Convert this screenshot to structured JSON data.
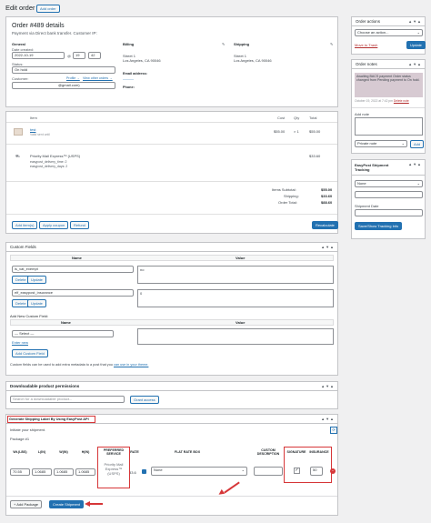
{
  "page": {
    "title": "Edit order",
    "add_order": "Add order"
  },
  "order": {
    "heading": "Order #489 details",
    "subheading": "Payment via Direct bank transfer. Customer IP: ",
    "general": {
      "title": "General",
      "date_label": "Date created:",
      "date": "2022-10-19",
      "at": "@",
      "hour": "19",
      "minute": "42",
      "status_label": "Status:",
      "status": "On hold",
      "customer_label": "Customer:",
      "profile_link": "Profile →",
      "other_orders_link": "View other orders →",
      "customer_value": "@gmail.com)"
    },
    "billing": {
      "title": "Billing",
      "address_line1": "Street 1",
      "address_line2": "Los Angeles, CA 90046",
      "email_label": "Email address:",
      "phone_label": "Phone:"
    },
    "shipping": {
      "title": "Shipping",
      "address_line1": "Street 1",
      "address_line2": "Los Angeles, CA 90046"
    }
  },
  "items": {
    "headers": {
      "item": "Item",
      "cost": "Cost",
      "qty": "Qty",
      "total": "Total"
    },
    "product": {
      "name": "test",
      "meta": "Valid sent until",
      "cost": "$55.00",
      "qty": "× 1",
      "total": "$55.00"
    },
    "shipping_line": {
      "name": "Priority Mail Express™ (USPS)",
      "meta1": "easypost_delivery_time: 2",
      "meta2": "easypost_delivery_days: 2",
      "total": "$33.60"
    },
    "totals": [
      {
        "label": "Items Subtotal:",
        "value": "$55.00"
      },
      {
        "label": "Shipping:",
        "value": "$33.60"
      },
      {
        "label": "Order Total:",
        "value": "$88.60"
      }
    ],
    "buttons": {
      "add_items": "Add item(s)",
      "apply_coupon": "Apply coupon",
      "refund": "Refund",
      "recalculate": "Recalculate"
    }
  },
  "custom_fields": {
    "title": "Custom Fields",
    "col_name": "Name",
    "col_value": "Value",
    "rows": [
      {
        "name": "is_vat_exempt",
        "value": "no"
      },
      {
        "name": "elf_easypost_insurance",
        "value": "0"
      }
    ],
    "delete": "Delete",
    "update": "Update",
    "add_new_title": "Add New Custom Field:",
    "select_placeholder": "— Select —",
    "enter_new": "Enter new",
    "add_button": "Add Custom Field",
    "footer_text": "Custom fields can be used to add extra metadata to a post that you ",
    "footer_link": "can use in your theme."
  },
  "downloads": {
    "title": "Downloadable product permissions",
    "search_placeholder": "Search for a downloadable product...",
    "grant_button": "Grant access"
  },
  "easypost": {
    "title": "Generate Shipping Label By Using EasyPost API",
    "initiate": "Initiate your shipment.",
    "package": "Package #1",
    "headers": {
      "wt": "Wt.(LBS)",
      "l": "L(IN)",
      "w": "W(IN)",
      "h": "H(IN)",
      "service": "PREFERRED SERVICE",
      "rate": "RATE",
      "flat": "FLAT RATE BOX",
      "desc": "CUSTOM DESCRIPTION",
      "signature": "SIGNATURE",
      "insurance": "INSURANCE"
    },
    "row": {
      "wt": "70.55",
      "l": "1.0685",
      "w": "1.0685",
      "h": "1.0685",
      "service": "Priority Mail Express™ (USPS)",
      "rate": "33.6",
      "flat": "None",
      "insurance": "50"
    },
    "add_package": "+ Add Package",
    "create_shipment": "Create Shipment"
  },
  "sidebar": {
    "actions": {
      "title": "Order actions",
      "select": "Choose an action...",
      "trash": "Move to Trash",
      "update": "Update"
    },
    "notes": {
      "title": "Order notes",
      "note_text": "Awaiting BACS payment Order status changed from Pending payment to On hold.",
      "note_meta": "October 19, 2022 at 7:42 pm",
      "delete_note": "Delete note",
      "add_note_label": "Add note",
      "note_type": "Private note",
      "add_button": "Add"
    },
    "tracking": {
      "title": "EasyPost Shipment Tracking",
      "select": "None",
      "date_label": "Shipment Date",
      "button": "Save/Show Tracking Info"
    }
  },
  "colors": {
    "accent": "#2271b1",
    "annotation": "#d63638",
    "note_bg": "#d7cad2"
  }
}
